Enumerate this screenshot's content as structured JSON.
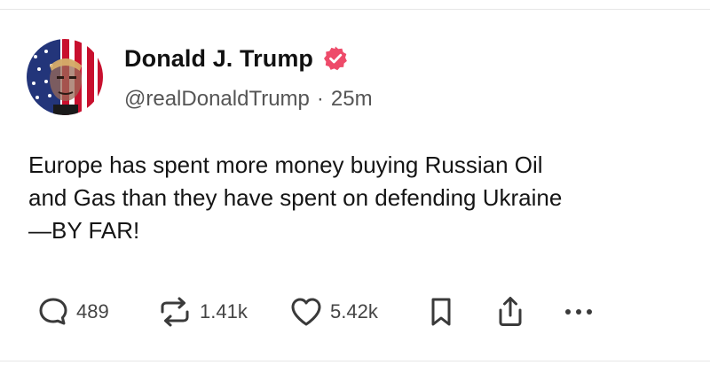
{
  "post": {
    "author_name": "Donald J. Trump",
    "handle": "@realDonaldTrump",
    "separator": "·",
    "time_ago": "25m",
    "verified": true,
    "text": "Europe has spent more money buying Russian Oil\nand Gas than they have spent on defending Ukraine\n—BY FAR!"
  },
  "actions": {
    "replies": "489",
    "reposts": "1.41k",
    "likes": "5.42k"
  },
  "icons": {
    "reply": "speech-bubble-icon",
    "repost": "repost-arrows-icon",
    "like": "heart-icon",
    "bookmark": "bookmark-icon",
    "share": "share-upload-icon",
    "more": "more-dots-icon",
    "verified": "verified-badge-icon"
  },
  "colors": {
    "verified_badge": "#ee4b6a",
    "text": "#151515",
    "muted": "#555555"
  }
}
